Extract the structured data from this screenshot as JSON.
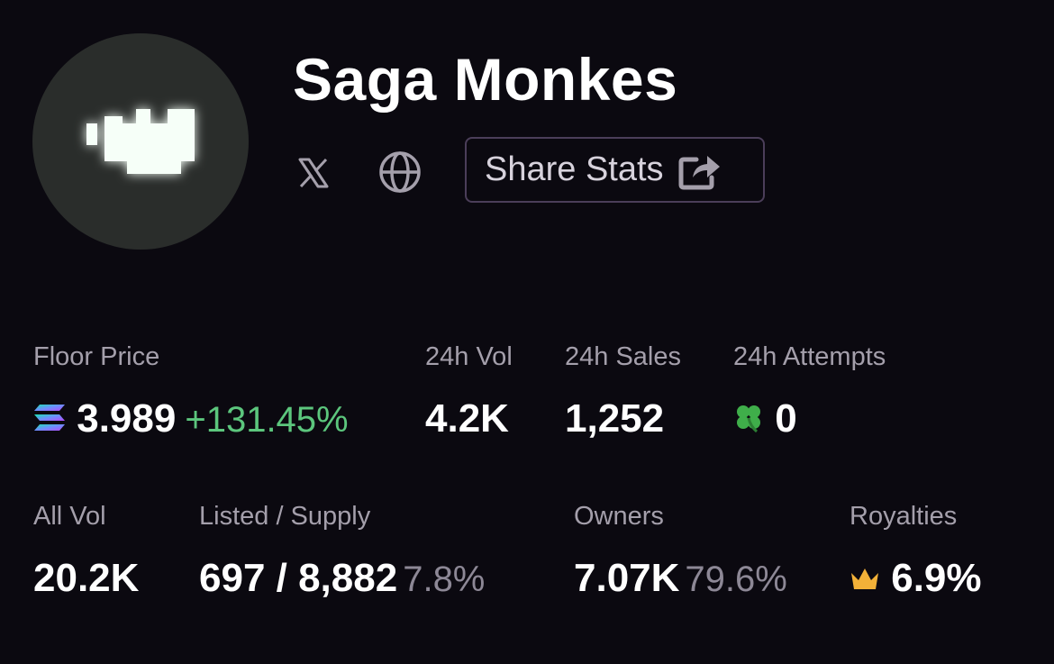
{
  "header": {
    "title": "Saga Monkes",
    "share_label": "Share Stats"
  },
  "icons": {
    "avatar": "pixel-monkey-avatar",
    "x": "x-logo-icon",
    "globe": "globe-icon",
    "share": "share-icon",
    "sol": "solana-icon",
    "clover": "four-leaf-clover-icon",
    "crown": "crown-icon"
  },
  "colors": {
    "background": "#0b0910",
    "label": "#a49fab",
    "positive": "#5cc67d",
    "muted": "#8d8896",
    "button_border": "#4b3e59",
    "crown": "#f2b138",
    "clover": "#3fae4a"
  },
  "stats": {
    "floor_price": {
      "label": "Floor Price",
      "value": "3.989",
      "change": "+131.45%"
    },
    "vol_24h": {
      "label": "24h Vol",
      "value": "4.2K"
    },
    "sales_24h": {
      "label": "24h Sales",
      "value": "1,252"
    },
    "attempts_24h": {
      "label": "24h Attempts",
      "value": "0"
    },
    "all_vol": {
      "label": "All Vol",
      "value": "20.2K"
    },
    "listed_supply": {
      "label": "Listed / Supply",
      "value": "697 / 8,882",
      "percent": "7.8%"
    },
    "owners": {
      "label": "Owners",
      "value": "7.07K",
      "percent": "79.6%"
    },
    "royalties": {
      "label": "Royalties",
      "value": "6.9%"
    }
  }
}
